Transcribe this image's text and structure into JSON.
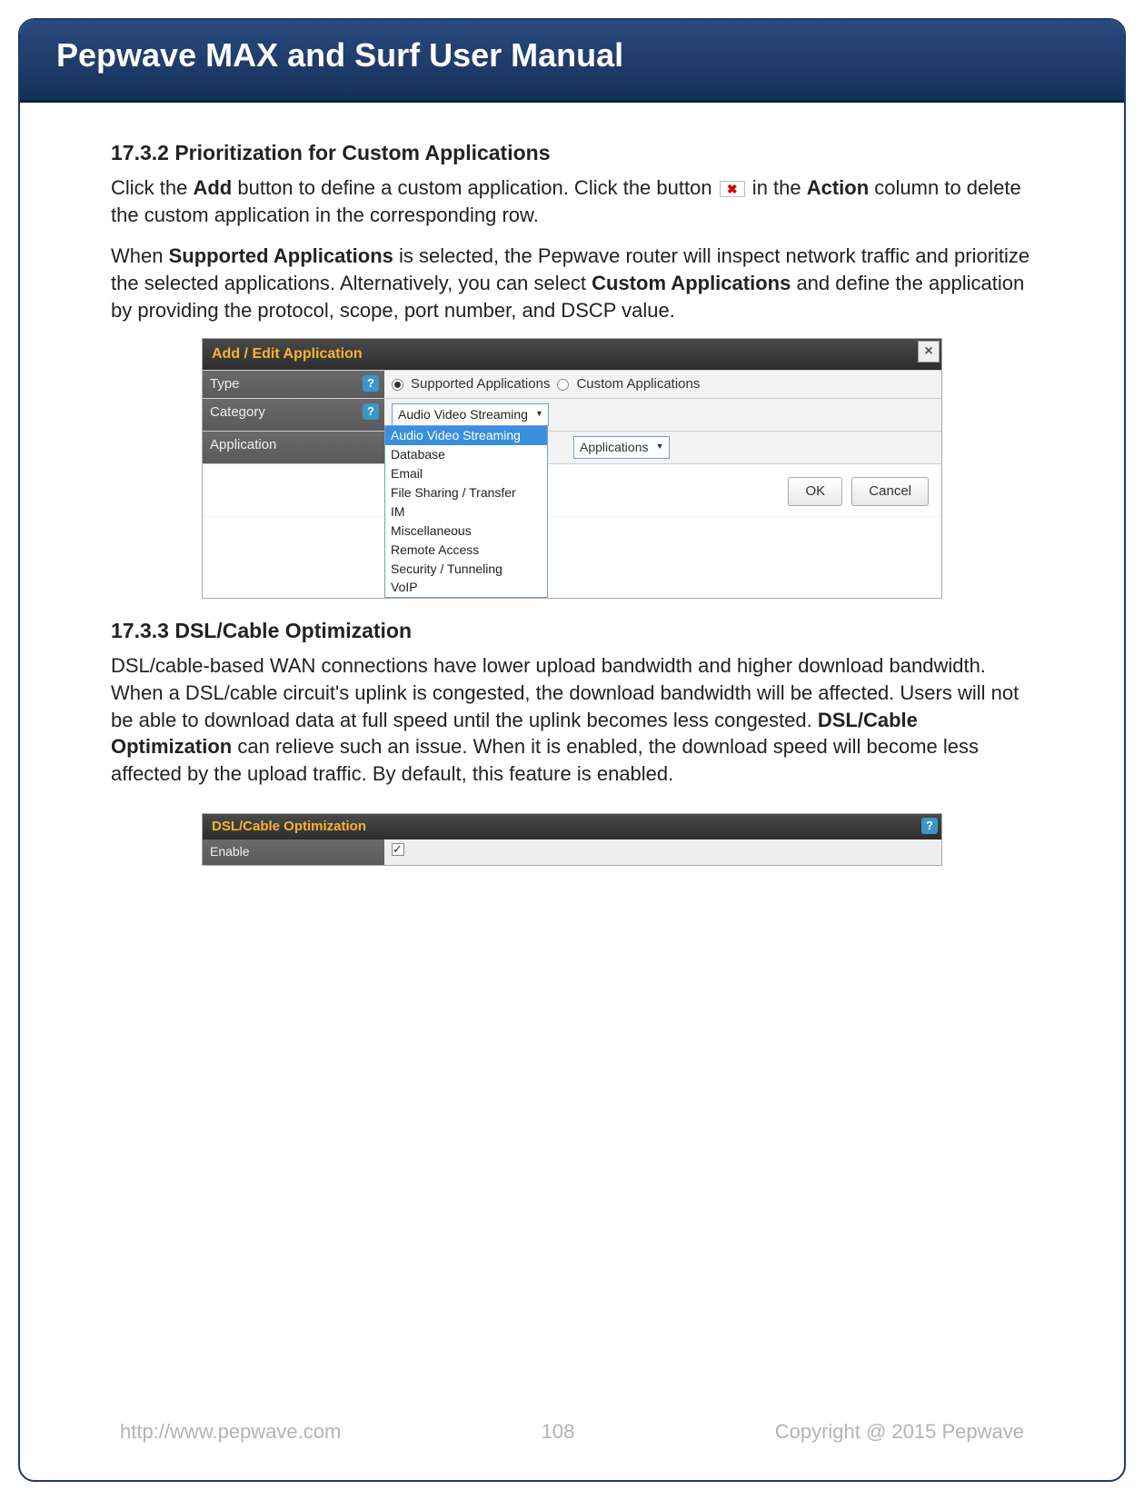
{
  "header": {
    "title": "Pepwave MAX and Surf User Manual"
  },
  "section1": {
    "heading": "17.3.2 Prioritization for Custom Applications",
    "p1a": "Click the ",
    "p1b": "Add",
    "p1c": " button to define a custom application. Click the button ",
    "p1d": " in the ",
    "p1e": "Action",
    "p1f": " column to delete the custom application in the corresponding row.",
    "p2a": "When ",
    "p2b": "Supported Applications",
    "p2c": " is selected, the Pepwave router will inspect network traffic and prioritize the selected applications. Alternatively, you can select ",
    "p2d": "Custom Applications",
    "p2e": " and define the application by providing the protocol, scope, port number, and DSCP value."
  },
  "dialog": {
    "title": "Add / Edit Application",
    "close": "×",
    "type_label": "Type",
    "category_label": "Category",
    "application_label": "Application",
    "type_opt1": "Supported Applications",
    "type_opt2": "Custom Applications",
    "category_value": "Audio Video Streaming",
    "app_select_peek": "Applications",
    "dropdown": {
      "selected": "Audio Video Streaming",
      "items": [
        "Database",
        "Email",
        "File Sharing / Transfer",
        "IM",
        "Miscellaneous",
        "Remote Access",
        "Security / Tunneling",
        "VoIP"
      ]
    },
    "ok": "OK",
    "cancel": "Cancel"
  },
  "section2": {
    "heading": "17.3.3 DSL/Cable Optimization",
    "p1a": "DSL/cable-based WAN connections have lower upload bandwidth and higher download bandwidth. When a DSL/cable circuit's uplink is congested, the download bandwidth will be affected. Users will not be able to download data at full speed until the uplink becomes less congested. ",
    "p1b": "DSL/Cable Optimization",
    "p1c": " can relieve such an issue. When it is enabled, the download speed will become less affected by the upload traffic. By default, this feature is enabled."
  },
  "dsl_panel": {
    "title": "DSL/Cable Optimization",
    "enable_label": "Enable"
  },
  "footer": {
    "url": "http://www.pepwave.com",
    "page": "108",
    "copyright": "Copyright @ 2015 Pepwave"
  },
  "icons": {
    "delete_x": "✖",
    "help_q": "?"
  }
}
